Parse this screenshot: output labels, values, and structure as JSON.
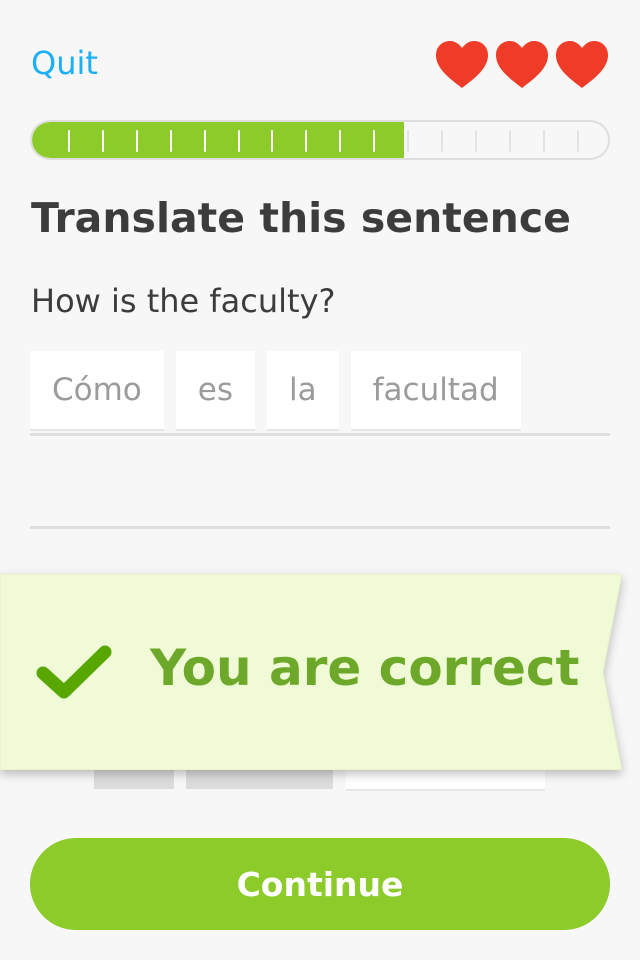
{
  "header": {
    "quit_label": "Quit",
    "hearts": {
      "count": 3,
      "icon": "heart-icon",
      "color": "#ee3c28"
    }
  },
  "progress": {
    "fraction": 0.645,
    "segments_total": 16,
    "segments_done": 10,
    "fill_color": "#8ccb2a"
  },
  "challenge": {
    "title": "Translate this sentence",
    "prompt": "How is the faculty?",
    "answer_words": [
      "Cómo",
      "es",
      "la",
      "facultad"
    ]
  },
  "feedback": {
    "icon": "checkmark-icon",
    "message": "You are correct",
    "color": "#6da82a",
    "background": "#f0fad6"
  },
  "footer": {
    "continue_label": "Continue"
  }
}
